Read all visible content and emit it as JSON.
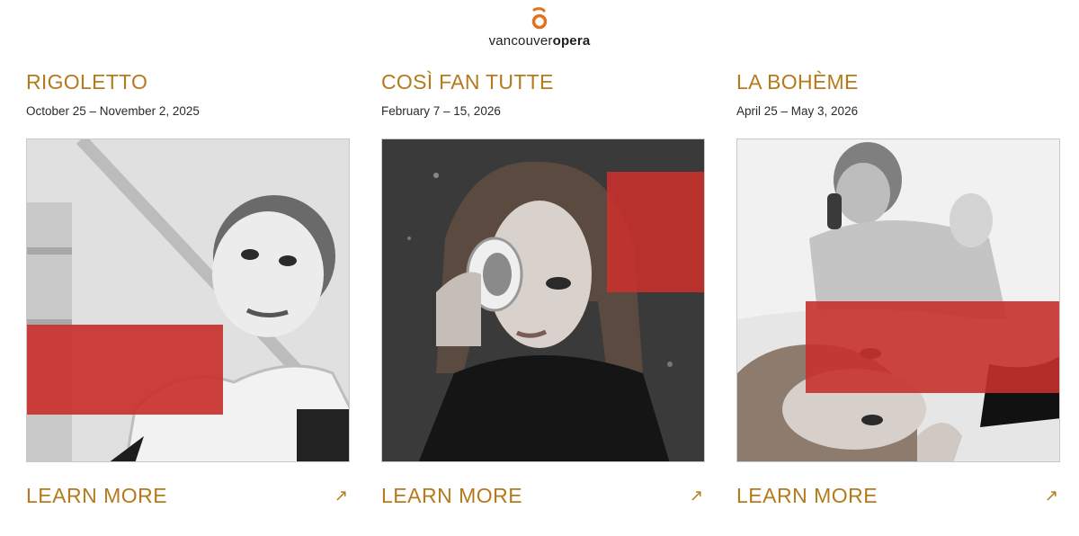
{
  "brand": {
    "logo_regular": "vancouver",
    "logo_bold": "opera",
    "logo_color": "#e0731f",
    "accent_gold": "#b47a1b",
    "accent_red": "#c8312c"
  },
  "productions": [
    {
      "title": "RIGOLETTO",
      "dates": "October 25 – November 2, 2025",
      "cta_label": "LEARN MORE",
      "cta_icon": "arrow-up-right-icon"
    },
    {
      "title": "COSÌ FAN TUTTE",
      "dates": "February 7 – 15, 2026",
      "cta_label": "LEARN MORE",
      "cta_icon": "arrow-up-right-icon"
    },
    {
      "title": "LA BOHÈME",
      "dates": "April 25 – May 3, 2026",
      "cta_label": "LEARN MORE",
      "cta_icon": "arrow-up-right-icon"
    }
  ]
}
